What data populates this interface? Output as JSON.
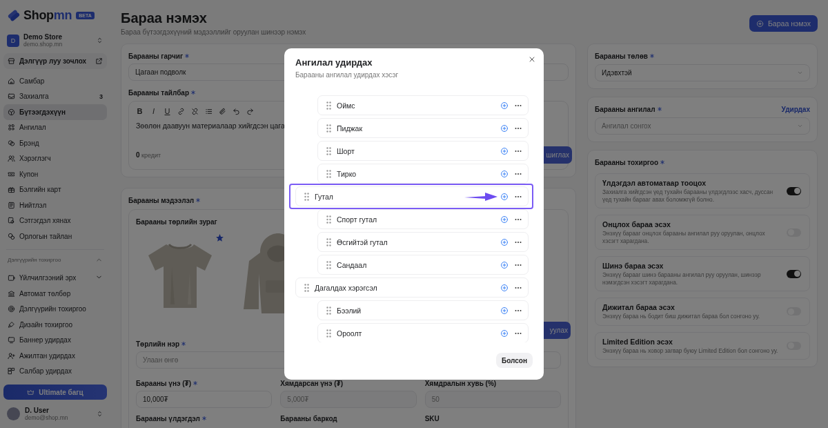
{
  "sidebar": {
    "brand": {
      "name_start": "Shop",
      "name_end": "mn",
      "badge": "BETA"
    },
    "store": {
      "initial": "D",
      "name": "Demo Store",
      "domain": "demo.shop.mn"
    },
    "visit_button": "Дэлгүүр луу зочлох",
    "nav": [
      {
        "label": "Самбар",
        "selected": false
      },
      {
        "label": "Захиалга",
        "count": "3",
        "selected": false
      },
      {
        "label": "Бүтээгдэхүүн",
        "selected": true
      },
      {
        "label": "Ангилал",
        "selected": false
      },
      {
        "label": "Брэнд",
        "selected": false
      },
      {
        "label": "Хэрэглэгч",
        "selected": false
      },
      {
        "label": "Купон",
        "selected": false
      },
      {
        "label": "Бэлгийн карт",
        "selected": false
      },
      {
        "label": "Нийтлэл",
        "selected": false
      },
      {
        "label": "Сэтгэгдэл хянах",
        "selected": false
      },
      {
        "label": "Орлогын тайлан",
        "selected": false
      }
    ],
    "settings_section": {
      "title": "Дэлгүүрийн тохиргоо",
      "expanded": true,
      "items": [
        {
          "label": "Үйлчилгээний эрх",
          "kind": "menu",
          "expanded": false
        },
        {
          "label": "Автомат төлбөр",
          "kind": "link"
        },
        {
          "label": "Дэлгүүрийн тохиргоо",
          "kind": "link"
        },
        {
          "label": "Дизайн тохиргоо",
          "kind": "link"
        },
        {
          "label": "Баннер удирдах",
          "kind": "link"
        },
        {
          "label": "Ажилтан удирдах",
          "kind": "link"
        },
        {
          "label": "Салбар удирдах",
          "kind": "link"
        }
      ]
    },
    "upgrade_button": "Ultimate багц",
    "user": {
      "name": "D. User",
      "email": "demo@shop.mn"
    }
  },
  "header": {
    "title": "Бараа нэмэх",
    "subtitle": "Бараа бүтээгдэхүүний мэдээллийг оруулан шинээр нэмэх",
    "add_button": "Бараа нэмэх"
  },
  "title_field": {
    "label": "Барааны гарчиг",
    "required": true,
    "value": "Цагаан подволк"
  },
  "description": {
    "label": "Барааны тайлбар",
    "required": true,
    "format_buttons": [
      "B",
      "I",
      "U"
    ],
    "text": "Зөөлөн даавуун материалаар хийгдсэн цага",
    "credits": "0",
    "credits_unit": "кредит",
    "action_button": "шиглах"
  },
  "info": {
    "label": "Барааны мэдээлэл",
    "required": true,
    "variant": {
      "images_label": "Барааны төрлийн зураг",
      "images": [
        {
          "kind": "picture",
          "primary": true
        },
        {
          "kind": "picture",
          "primary": false
        }
      ],
      "upload_button": "уулах",
      "name_field": {
        "label": "Төрлийн нэр",
        "required": true,
        "placeholder": "Улаан өнгө"
      },
      "price_fields": [
        {
          "label": "Барааны үнэ (₮)",
          "required": true,
          "value": "10,000₮"
        },
        {
          "label": "Хямдарсан үнэ (₮)",
          "required": false,
          "placeholder": "5,000₮"
        },
        {
          "label": "Хямдралын хувь (%)",
          "required": false,
          "placeholder": "50"
        }
      ],
      "stock_labels": [
        {
          "label": "Барааны үлдэгдэл",
          "required": true
        },
        {
          "label": "Барааны баркод",
          "required": false
        },
        {
          "label": "SKU",
          "required": false
        }
      ]
    }
  },
  "status": {
    "label": "Барааны төлөв",
    "required": true,
    "value": "Идэвхтэй"
  },
  "category": {
    "label": "Барааны ангилал",
    "required": true,
    "manage_link": "Удирдах",
    "placeholder": "Ангилал сонгох"
  },
  "settings": {
    "label": "Барааны тохиргоо",
    "required": true,
    "toggles": [
      {
        "title": "Үлдэгдэл автоматаар тооцох",
        "description": "Захиалга хийгдсэн үед тухайн барааны үлдэгдлээс хасч, дуссан үед тухайн барааг авах боломжгүй болно.",
        "on": true
      },
      {
        "title": "Онцлох бараа эсэх",
        "description": "Энэхүү барааг онцлох барааны ангилал руу оруулан, онцлох хэсэгт харагдана.",
        "on": false
      },
      {
        "title": "Шинэ бараа эсэх",
        "description": "Энэхүү барааг шинэ барааны ангилал руу оруулан, шинээр нэмэгдсэн хэсэгт харагдана.",
        "on": true
      },
      {
        "title": "Дижитал бараа эсэх",
        "description": "Энэхүү бараа нь бодит биш дижитал бараа бол сонгоно уу.",
        "on": false
      },
      {
        "title": "Limited Edition эсэх",
        "description": "Энэхүү бараа нь ховор загвар буюу Limited Edition бол сонгоно уу.",
        "on": false
      }
    ]
  },
  "modal": {
    "title": "Ангилал удирдах",
    "subtitle": "Барааны ангилал удирдах хэсэг",
    "tree": [
      {
        "children": [
          {
            "name": "Оймс",
            "highlighted": false
          },
          {
            "name": "Пиджак",
            "highlighted": false
          },
          {
            "name": "Шорт",
            "highlighted": false
          },
          {
            "name": "Тирко",
            "highlighted": false
          }
        ]
      },
      {
        "name": "Гутал",
        "highlighted": true,
        "children": [
          {
            "name": "Спорт гутал",
            "highlighted": false
          },
          {
            "name": "Өсгийтэй гутал",
            "highlighted": false
          },
          {
            "name": "Сандаал",
            "highlighted": false
          }
        ]
      },
      {
        "name": "Дагалдах хэрэгсэл",
        "highlighted": false,
        "children": [
          {
            "name": "Бээлий",
            "highlighted": false
          },
          {
            "name": "Ороолт",
            "highlighted": false
          }
        ]
      }
    ],
    "done_button": "Болсон"
  }
}
